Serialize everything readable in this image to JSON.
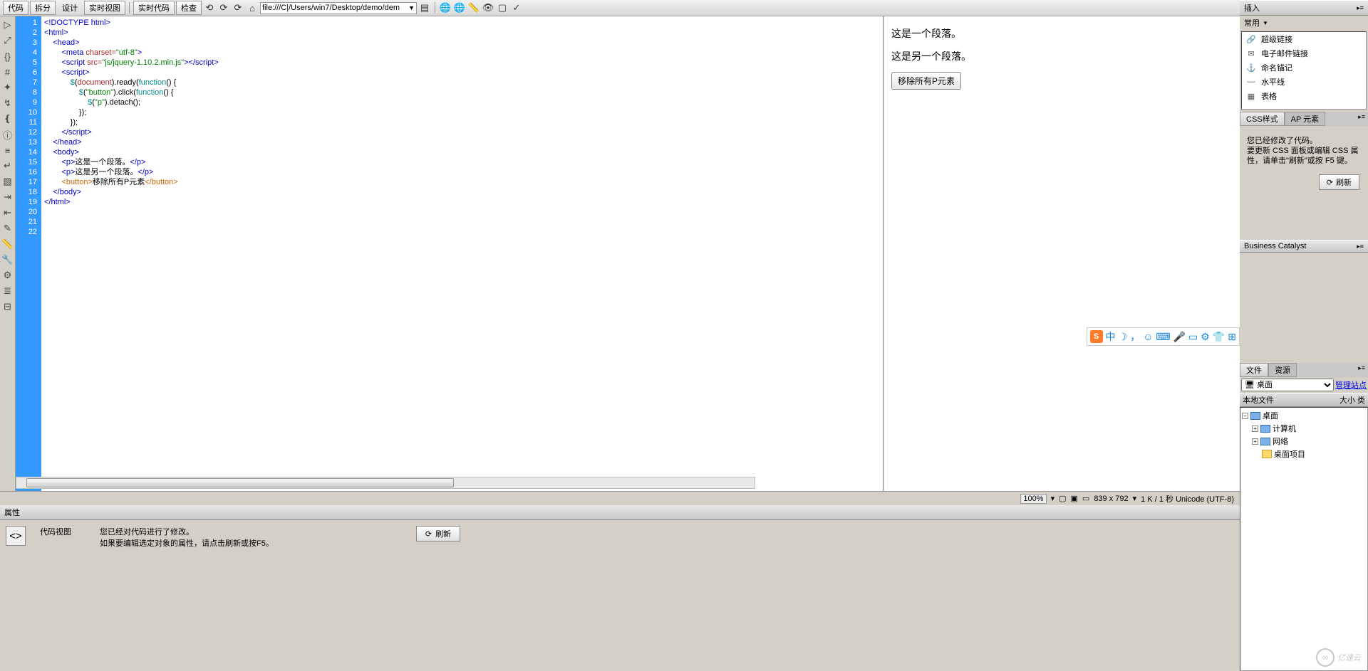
{
  "toolbar": {
    "view_code": "代码",
    "view_split": "拆分",
    "view_design": "设计",
    "view_live": "实时视图",
    "live_code": "实时代码",
    "inspect": "检查",
    "address": "file:///C|/Users/win7/Desktop/demo/dem"
  },
  "code_lines": [
    {
      "n": 1,
      "html": "<span class='t-blue'>&lt;!DOCTYPE html&gt;</span>"
    },
    {
      "n": 2,
      "html": "<span class='t-blue'>&lt;html&gt;</span>"
    },
    {
      "n": 3,
      "html": "    <span class='t-blue'>&lt;head&gt;</span>"
    },
    {
      "n": 4,
      "html": "        <span class='t-blue'>&lt;meta</span> <span class='t-brown'>charset=</span><span class='t-green'>\"utf-8\"</span><span class='t-blue'>&gt;</span>"
    },
    {
      "n": 5,
      "html": "        <span class='t-blue'>&lt;script</span> <span class='t-brown'>src=</span><span class='t-green'>\"js/jquery-1.10.2.min.js\"</span><span class='t-blue'>&gt;&lt;/script&gt;</span>"
    },
    {
      "n": 6,
      "html": "        <span class='t-blue'>&lt;script&gt;</span>"
    },
    {
      "n": 7,
      "html": "            <span class='t-teal'>$</span>(<span class='t-brown'>document</span>).ready(<span class='t-teal'>function</span>() {"
    },
    {
      "n": 8,
      "html": "                <span class='t-teal'>$</span>(<span class='t-green'>\"button\"</span>).click(<span class='t-teal'>function</span>() {"
    },
    {
      "n": 9,
      "html": "                    <span class='t-teal'>$</span>(<span class='t-green'>\"p\"</span>).detach();"
    },
    {
      "n": 10,
      "html": "                });"
    },
    {
      "n": 11,
      "html": "            });"
    },
    {
      "n": 12,
      "html": "        <span class='t-blue'>&lt;/script&gt;</span>"
    },
    {
      "n": 13,
      "html": "    <span class='t-blue'>&lt;/head&gt;</span>"
    },
    {
      "n": 14,
      "html": "    <span class='t-blue'>&lt;body&gt;</span>"
    },
    {
      "n": 15,
      "html": ""
    },
    {
      "n": 16,
      "html": "        <span class='t-blue'>&lt;p&gt;</span>这是一个段落。<span class='t-blue'>&lt;/p&gt;</span>"
    },
    {
      "n": 17,
      "html": "        <span class='t-blue'>&lt;p&gt;</span>这是另一个段落。<span class='t-blue'>&lt;/p&gt;</span>"
    },
    {
      "n": 18,
      "html": "        <span class='t-orange'>&lt;button&gt;</span>移除所有P元素<span class='t-orange'>&lt;/button&gt;</span>"
    },
    {
      "n": 19,
      "html": ""
    },
    {
      "n": 20,
      "html": "    <span class='t-blue'>&lt;/body&gt;</span>"
    },
    {
      "n": 21,
      "html": "<span class='t-blue'>&lt;/html&gt;</span>"
    },
    {
      "n": 22,
      "html": ""
    }
  ],
  "preview": {
    "p1": "这是一个段落。",
    "p2": "这是另一个段落。",
    "btn": "移除所有P元素"
  },
  "right": {
    "insert_hdr": "插入",
    "common": "常用",
    "items": [
      {
        "icon": "🔗",
        "label": "超级链接"
      },
      {
        "icon": "✉",
        "label": "电子邮件链接"
      },
      {
        "icon": "⚓",
        "label": "命名锚记"
      },
      {
        "icon": "—",
        "label": "水平线"
      },
      {
        "icon": "▦",
        "label": "表格"
      }
    ],
    "css_tab": "CSS样式",
    "ap_tab": "AP 元素",
    "css_msg": "您已经修改了代码。\n要更新 CSS 面板或编辑 CSS 属性，请单击\"刷新\"或按 F5 键。",
    "refresh": "刷新",
    "bc": "Business Catalyst",
    "files_tab": "文件",
    "res_tab": "资源",
    "site_sel": "桌面",
    "manage": "管理站点",
    "local_files": "本地文件",
    "size_type": "大小 类",
    "tree": [
      {
        "lvl": 0,
        "box": "−",
        "ico": "drv",
        "label": "桌面"
      },
      {
        "lvl": 1,
        "box": "+",
        "ico": "drv",
        "label": "计算机"
      },
      {
        "lvl": 1,
        "box": "+",
        "ico": "drv",
        "label": "网络"
      },
      {
        "lvl": 1,
        "box": "",
        "ico": "fold",
        "label": "桌面项目"
      }
    ]
  },
  "status": {
    "zoom": "100%",
    "dims": "839 x 792",
    "info": "1 K / 1 秒 Unicode (UTF-8)"
  },
  "props": {
    "hdr": "属性",
    "title": "代码视图",
    "msg1": "您已经对代码进行了修改。",
    "msg2": "如果要编辑选定对象的属性，请点击刷新或按F5。",
    "refresh": "刷新"
  },
  "ime": [
    "中",
    "☽",
    ",",
    "☺",
    "⌨",
    "🎤",
    "▭",
    "⚙",
    "👕",
    "⬚"
  ],
  "watermark": "亿速云"
}
